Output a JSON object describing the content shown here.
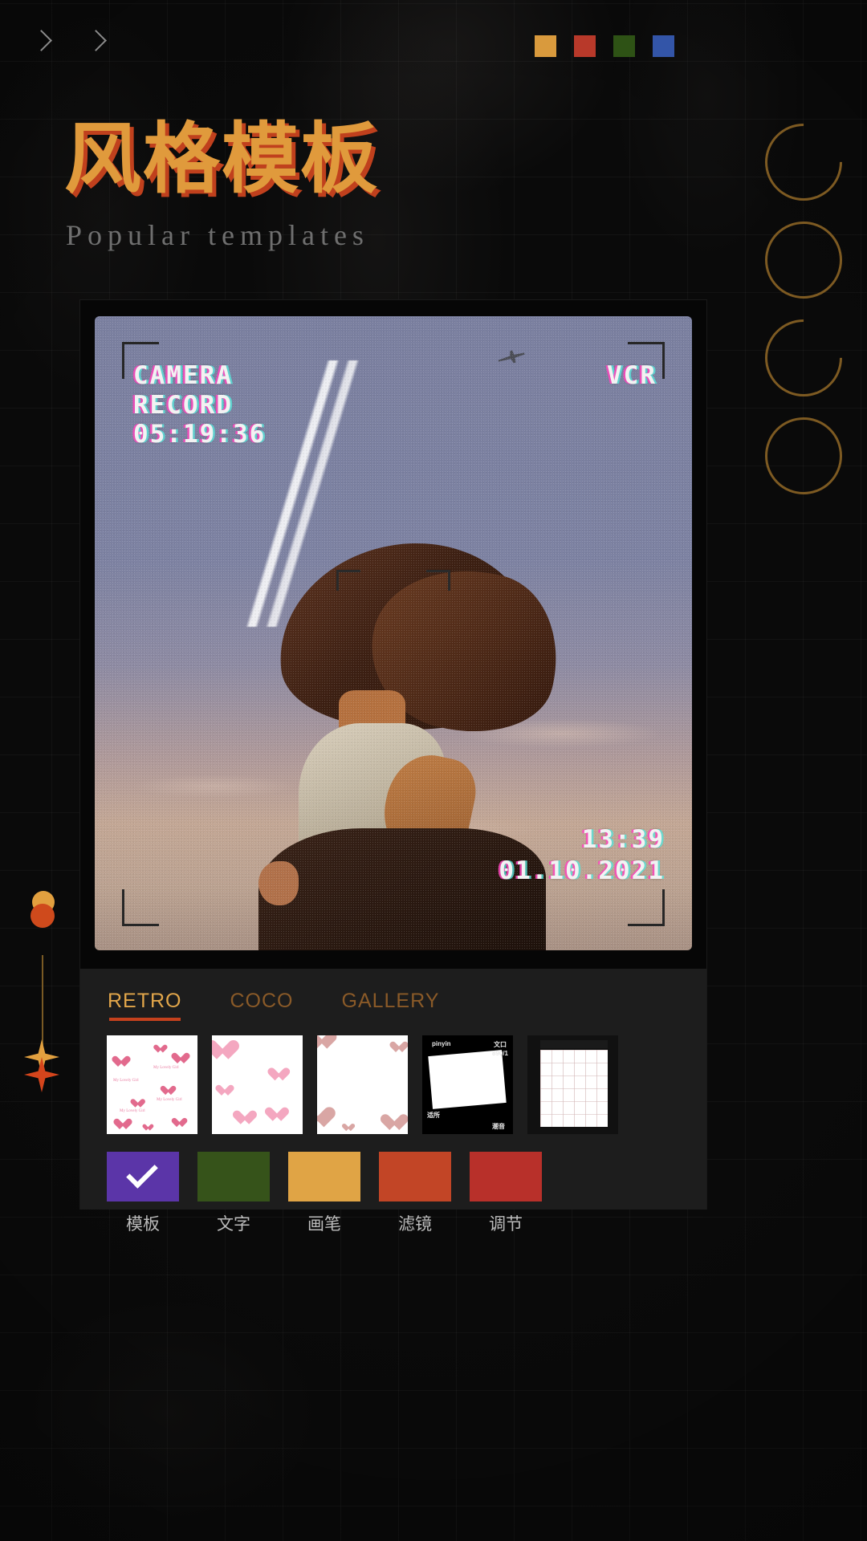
{
  "header": {
    "nav_chevrons": [
      "chevron-right",
      "chevron-right"
    ],
    "swatches": [
      {
        "name": "swatch-amber",
        "color": "#d99a3d"
      },
      {
        "name": "swatch-red",
        "color": "#b8392a"
      },
      {
        "name": "swatch-green",
        "color": "#2e5215"
      },
      {
        "name": "swatch-blue",
        "color": "#3355a8"
      }
    ]
  },
  "title": {
    "zh": "风格模板",
    "en": "Popular templates",
    "zh_color": "#e09a3c",
    "zh_shadow": "#c0401d",
    "en_color": "#6f6f6f"
  },
  "side_letters": [
    "C",
    "O",
    "C",
    "O"
  ],
  "editor": {
    "overlay": {
      "label_camera": "CAMERA",
      "label_record": "RECORD",
      "timecode": "05:19:36",
      "mode": "VCR",
      "clock": "13:39",
      "date": "01.10.2021"
    }
  },
  "panel": {
    "tabs": [
      {
        "label": "RETRO",
        "active": true
      },
      {
        "label": "COCO",
        "active": false
      },
      {
        "label": "GALLERY",
        "active": false
      }
    ],
    "thumbnails": [
      {
        "name": "thumb-hearts-scatter",
        "style": "hearts-small",
        "caption": "My Lovely Girl"
      },
      {
        "name": "thumb-hearts-pink",
        "style": "hearts-pink"
      },
      {
        "name": "thumb-hearts-glossy",
        "style": "hearts-glossy"
      },
      {
        "name": "thumb-pinyin-frame",
        "style": "dark-frame",
        "caption": "pinyin"
      },
      {
        "name": "thumb-phone-grid",
        "style": "phone-grid"
      }
    ],
    "tools": [
      {
        "label": "模板",
        "color": "#5b35a8",
        "selected": true
      },
      {
        "label": "文字",
        "color": "#36531a",
        "selected": false
      },
      {
        "label": "画笔",
        "color": "#e0a445",
        "selected": false
      },
      {
        "label": "滤镜",
        "color": "#c24526",
        "selected": false
      },
      {
        "label": "调节",
        "color": "#b8302a",
        "selected": false
      }
    ]
  },
  "decorations": {
    "dot_amber": "#e2a03f",
    "dot_red": "#cf4a1c",
    "line_color": "#7a5a24",
    "spark_amber": "#e2a03f",
    "spark_red": "#d5451c"
  }
}
